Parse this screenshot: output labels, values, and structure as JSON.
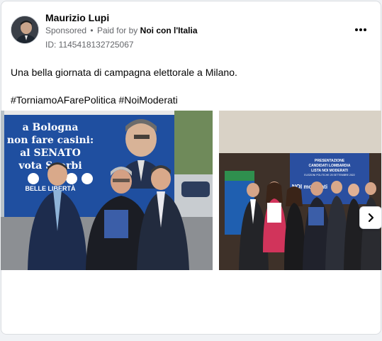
{
  "post": {
    "author": "Maurizio Lupi",
    "sponsored_label": "Sponsored",
    "separator": "•",
    "paid_for_prefix": "Paid for by",
    "paid_for_by": "Noi con l'Italia",
    "ad_id": "ID: 1145418132725067",
    "text": "Una bella giornata di campagna elettorale a Milano.",
    "hashtags": "#TorniamoAFarePolitica #NoiModerati"
  },
  "photo1": {
    "billboard_lines": [
      "a Bologna",
      "non fare casini:",
      "al SENATO",
      "vota Sgarbi"
    ],
    "billboard_footer": "BELLE   LIBERTÀ"
  },
  "photo2": {
    "screen_lines": [
      "PRESENTAZIONE",
      "CANDIDATI LOMBARDIA",
      "LISTA NOI MODERATI",
      "ELEZIONI POLITICHE 25 SETTEMBRE 2022"
    ],
    "screen_logo": "NOI moderati"
  },
  "icons": {
    "more": "more-horizontal-icon",
    "next": "chevron-right-icon"
  },
  "colors": {
    "text_primary": "#050505",
    "text_secondary": "#65676b",
    "card_bg": "#ffffff",
    "page_bg": "#f0f2f5"
  }
}
